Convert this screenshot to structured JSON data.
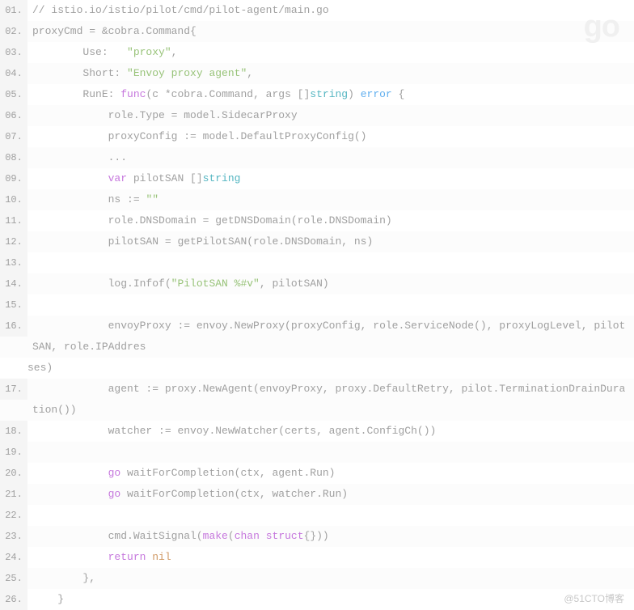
{
  "badge": "go",
  "watermark": "@51CTO博客",
  "lines": [
    {
      "num": "01.",
      "tokens": [
        {
          "t": "// istio.io/istio/pilot/cmd/pilot-agent/main.go",
          "c": "ident"
        }
      ]
    },
    {
      "num": "02.",
      "tokens": [
        {
          "t": "proxyCmd = &cobra.Command{",
          "c": "ident"
        }
      ]
    },
    {
      "num": "03.",
      "tokens": [
        {
          "t": "        Use:   ",
          "c": "ident"
        },
        {
          "t": "\"proxy\"",
          "c": "str"
        },
        {
          "t": ",",
          "c": "ident"
        }
      ]
    },
    {
      "num": "04.",
      "tokens": [
        {
          "t": "        Short: ",
          "c": "ident"
        },
        {
          "t": "\"Envoy proxy agent\"",
          "c": "str"
        },
        {
          "t": ",",
          "c": "ident"
        }
      ]
    },
    {
      "num": "05.",
      "tokens": [
        {
          "t": "        RunE: ",
          "c": "ident"
        },
        {
          "t": "func",
          "c": "kw"
        },
        {
          "t": "(c *cobra.Command, args []",
          "c": "ident"
        },
        {
          "t": "string",
          "c": "type"
        },
        {
          "t": ") ",
          "c": "ident"
        },
        {
          "t": "error",
          "c": "fn"
        },
        {
          "t": " {",
          "c": "ident"
        }
      ]
    },
    {
      "num": "06.",
      "tokens": [
        {
          "t": "            role.Type = model.SidecarProxy",
          "c": "ident"
        }
      ]
    },
    {
      "num": "07.",
      "tokens": [
        {
          "t": "            proxyConfig := model.DefaultProxyConfig()",
          "c": "ident"
        }
      ]
    },
    {
      "num": "08.",
      "tokens": [
        {
          "t": "            ...",
          "c": "ident"
        }
      ]
    },
    {
      "num": "09.",
      "tokens": [
        {
          "t": "            ",
          "c": "ident"
        },
        {
          "t": "var",
          "c": "kw"
        },
        {
          "t": " pilotSAN []",
          "c": "ident"
        },
        {
          "t": "string",
          "c": "type"
        }
      ]
    },
    {
      "num": "10.",
      "tokens": [
        {
          "t": "            ns := ",
          "c": "ident"
        },
        {
          "t": "\"\"",
          "c": "str"
        }
      ]
    },
    {
      "num": "11.",
      "tokens": [
        {
          "t": "            role.DNSDomain = getDNSDomain(role.DNSDomain)",
          "c": "ident"
        }
      ]
    },
    {
      "num": "12.",
      "tokens": [
        {
          "t": "            pilotSAN = getPilotSAN(role.DNSDomain, ns)",
          "c": "ident"
        }
      ]
    },
    {
      "num": "13.",
      "tokens": [
        {
          "t": "",
          "c": "ident"
        }
      ]
    },
    {
      "num": "14.",
      "tokens": [
        {
          "t": "            log.Infof(",
          "c": "ident"
        },
        {
          "t": "\"PilotSAN %#v\"",
          "c": "str"
        },
        {
          "t": ", pilotSAN)",
          "c": "ident"
        }
      ]
    },
    {
      "num": "15.",
      "tokens": [
        {
          "t": "",
          "c": "ident"
        }
      ]
    },
    {
      "num": "16.",
      "tokens": [
        {
          "t": "            envoyProxy := envoy.NewProxy(proxyConfig, role.ServiceNode(), proxyLogLevel, pilotSAN, role.IPAddres",
          "c": "ident"
        }
      ],
      "wrap": [
        {
          "t": "ses)",
          "c": "ident"
        }
      ]
    },
    {
      "num": "17.",
      "tokens": [
        {
          "t": "            agent := proxy.NewAgent(envoyProxy, proxy.DefaultRetry, pilot.TerminationDrainDuration())",
          "c": "ident"
        }
      ]
    },
    {
      "num": "18.",
      "tokens": [
        {
          "t": "            watcher := envoy.NewWatcher(certs, agent.ConfigCh())",
          "c": "ident"
        }
      ]
    },
    {
      "num": "19.",
      "tokens": [
        {
          "t": "",
          "c": "ident"
        }
      ]
    },
    {
      "num": "20.",
      "tokens": [
        {
          "t": "            ",
          "c": "ident"
        },
        {
          "t": "go",
          "c": "kw"
        },
        {
          "t": " waitForCompletion(ctx, agent.Run)",
          "c": "ident"
        }
      ]
    },
    {
      "num": "21.",
      "tokens": [
        {
          "t": "            ",
          "c": "ident"
        },
        {
          "t": "go",
          "c": "kw"
        },
        {
          "t": " waitForCompletion(ctx, watcher.Run)",
          "c": "ident"
        }
      ]
    },
    {
      "num": "22.",
      "tokens": [
        {
          "t": "",
          "c": "ident"
        }
      ]
    },
    {
      "num": "23.",
      "tokens": [
        {
          "t": "            cmd.WaitSignal(",
          "c": "ident"
        },
        {
          "t": "make",
          "c": "kw"
        },
        {
          "t": "(",
          "c": "ident"
        },
        {
          "t": "chan",
          "c": "kw"
        },
        {
          "t": " ",
          "c": "ident"
        },
        {
          "t": "struct",
          "c": "kw"
        },
        {
          "t": "{}))",
          "c": "ident"
        }
      ]
    },
    {
      "num": "24.",
      "tokens": [
        {
          "t": "            ",
          "c": "ident"
        },
        {
          "t": "return",
          "c": "kw"
        },
        {
          "t": " ",
          "c": "ident"
        },
        {
          "t": "nil",
          "c": "kw2"
        }
      ]
    },
    {
      "num": "25.",
      "tokens": [
        {
          "t": "        },",
          "c": "ident"
        }
      ]
    },
    {
      "num": "26.",
      "tokens": [
        {
          "t": "    }",
          "c": "ident"
        }
      ]
    }
  ]
}
